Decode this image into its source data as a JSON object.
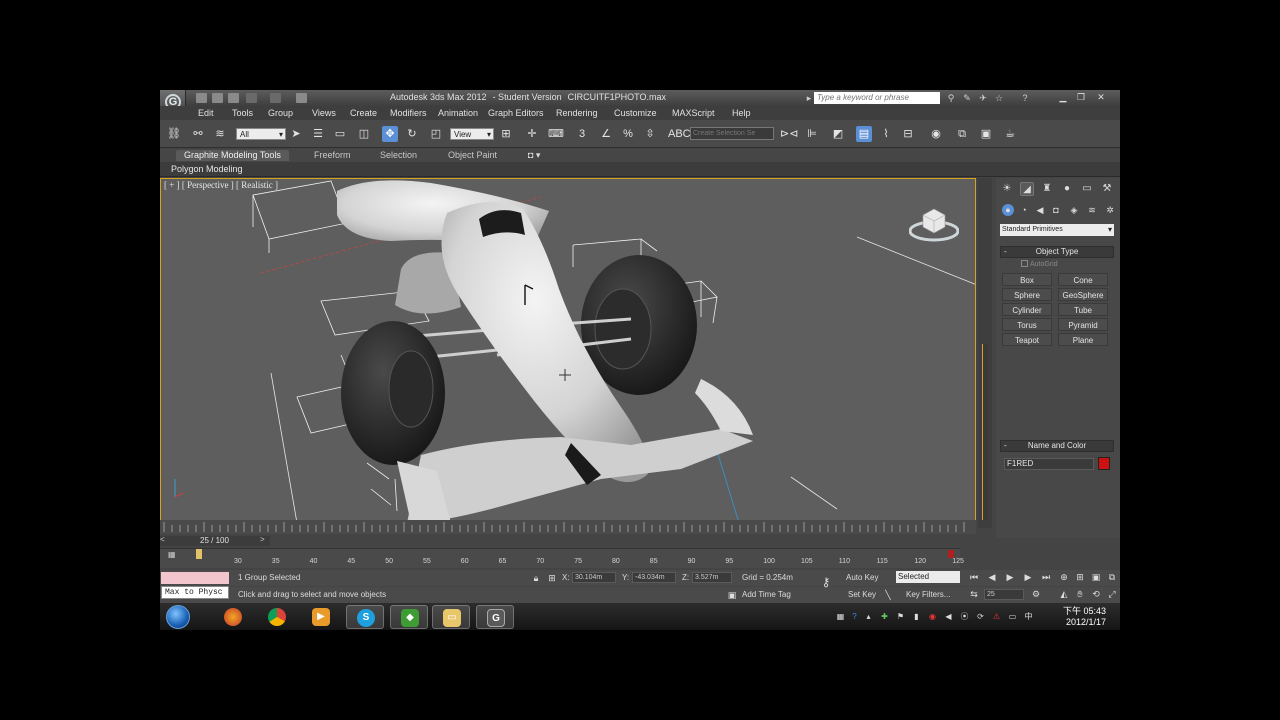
{
  "title": {
    "app": "Autodesk 3ds Max 2012",
    "edition": "- Student Version",
    "file": "CIRCUITF1PHOTO.max",
    "search_placeholder": "Type a keyword or phrase"
  },
  "menu": [
    "Edit",
    "Tools",
    "Group",
    "Views",
    "Create",
    "Modifiers",
    "Animation",
    "Graph Editors",
    "Rendering",
    "Customize",
    "MAXScript",
    "Help"
  ],
  "toolbar": {
    "selection_filter": "All",
    "ref_coord": "View",
    "named_selection_placeholder": "Create Selection Se"
  },
  "ribbon": {
    "tabs": [
      "Graphite Modeling Tools",
      "Freeform",
      "Selection",
      "Object Paint"
    ],
    "panel_label": "Polygon Modeling"
  },
  "viewport": {
    "label": "[ + ] [ Perspective ] [ Realistic ]"
  },
  "command_panel": {
    "category": "Standard Primitives",
    "object_type_header": "Object Type",
    "autogrid_label": "AutoGrid",
    "primitives": [
      "Box",
      "Cone",
      "Sphere",
      "GeoSphere",
      "Cylinder",
      "Tube",
      "Torus",
      "Pyramid",
      "Teapot",
      "Plane"
    ],
    "name_color_header": "Name and Color",
    "object_name": "F1RED",
    "object_color": "#cc1111"
  },
  "timeline": {
    "frame_display": "25 / 100",
    "ticks": [
      "30",
      "35",
      "40",
      "45",
      "50",
      "55",
      "60",
      "65",
      "70",
      "75",
      "80",
      "85",
      "90",
      "95",
      "100",
      "105",
      "110",
      "115",
      "120",
      "125"
    ]
  },
  "status": {
    "selection_info": "1 Group Selected",
    "prompt": "Click and drag to select and move objects",
    "mini_listener": "Max to Physc",
    "x_label": "X:",
    "x_value": "30.104m",
    "y_label": "Y:",
    "y_value": "-43.034m",
    "z_label": "Z:",
    "z_value": "3.527m",
    "grid": "Grid = 0.254m",
    "add_time_tag": "Add Time Tag",
    "auto_key": "Auto Key",
    "set_key": "Set Key",
    "selected_option": "Selected",
    "key_filters": "Key Filters...",
    "current_frame": "25"
  },
  "taskbar": {
    "time": "下午 05:43",
    "date": "2012/1/17"
  },
  "colors": {
    "accent": "#5b8fd6",
    "viewport_border": "#d8a420"
  }
}
